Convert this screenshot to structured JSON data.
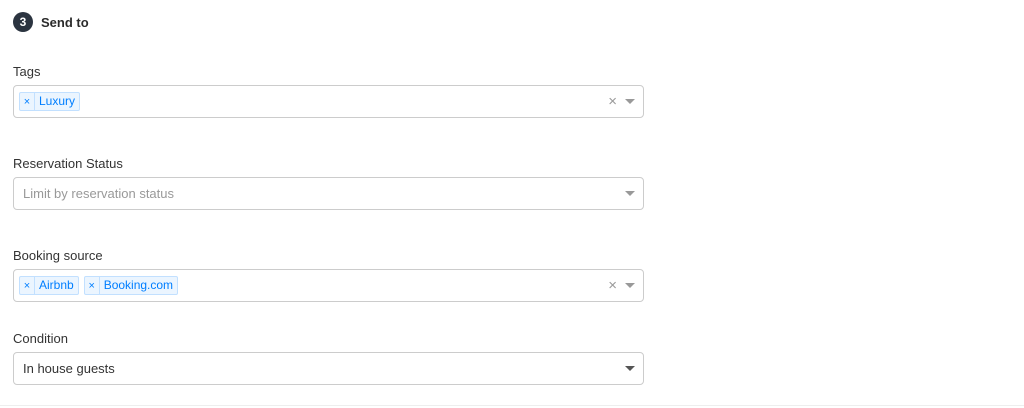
{
  "step": {
    "number": "3",
    "title": "Send to"
  },
  "tags": {
    "label": "Tags",
    "chips": [
      "Luxury"
    ],
    "remove_glyph": "×",
    "clear_glyph": "×"
  },
  "reservation_status": {
    "label": "Reservation Status",
    "placeholder": "Limit by reservation status"
  },
  "booking_source": {
    "label": "Booking source",
    "chips": [
      "Airbnb",
      "Booking.com"
    ],
    "remove_glyph": "×",
    "clear_glyph": "×"
  },
  "condition": {
    "label": "Condition",
    "value": "In house guests"
  },
  "colors": {
    "chip_text": "#007eff",
    "chip_bg": "#ebf5ff",
    "step_badge": "#2b3440"
  }
}
